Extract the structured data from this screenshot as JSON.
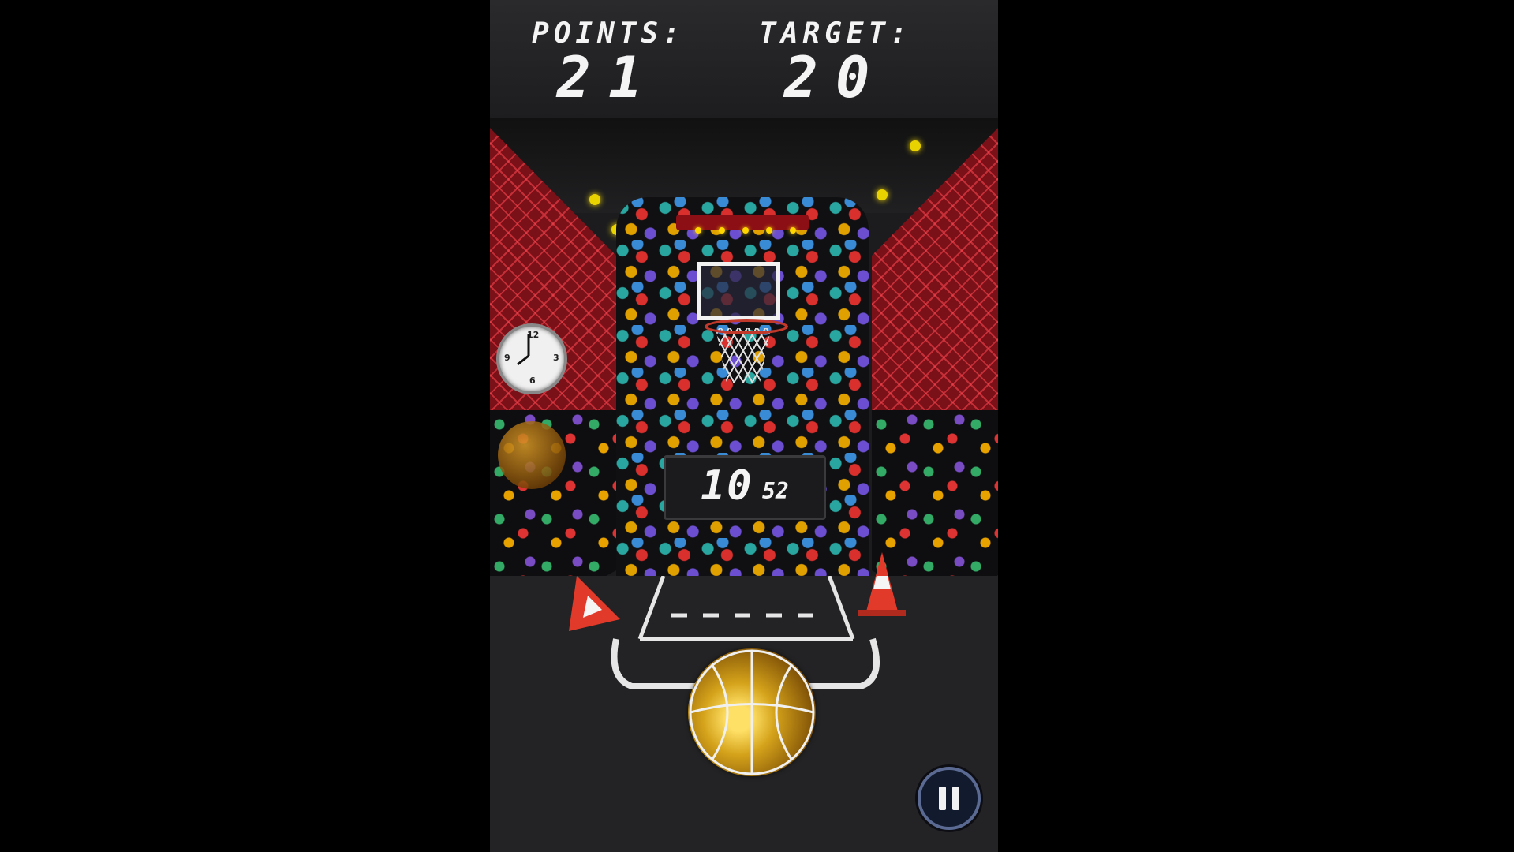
{
  "scoreboard": {
    "points_label": "POINTS:",
    "points_value": "21",
    "target_label": "TARGET:",
    "target_value": "20"
  },
  "timer": {
    "seconds": "10",
    "hundredths": "52"
  },
  "clock": {
    "numbers": [
      "12",
      "3",
      "6",
      "9"
    ]
  },
  "controls": {
    "pause_icon": "pause-icon"
  },
  "colors": {
    "net": "#7a1018",
    "ball": "#d4a21a",
    "cone": "#e23a2a",
    "rim": "#c0392b"
  }
}
